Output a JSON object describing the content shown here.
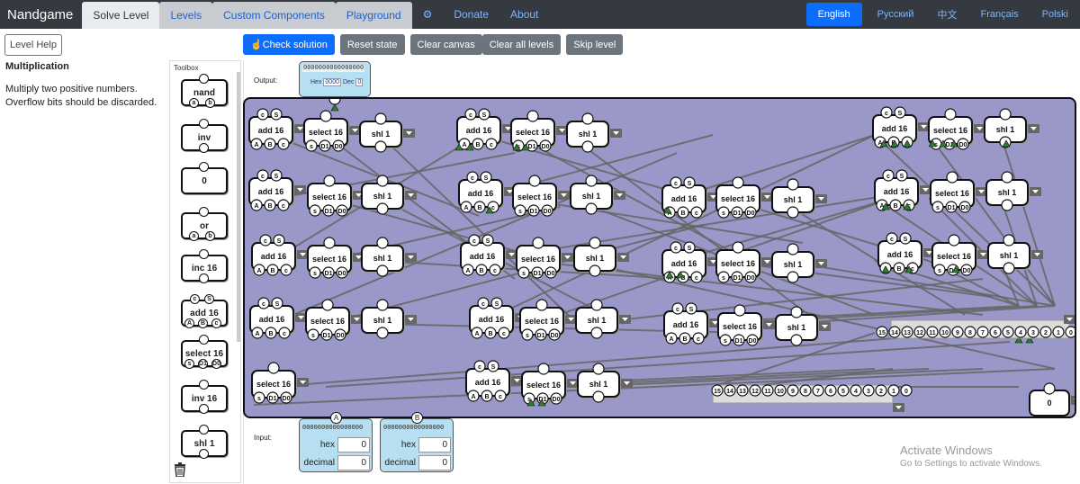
{
  "nav": {
    "brand": "Nandgame",
    "items": [
      "Solve Level",
      "Levels",
      "Custom Components",
      "Playground",
      "Donate",
      "About"
    ],
    "languages": [
      "English",
      "Русский",
      "中文",
      "Français",
      "Polski"
    ]
  },
  "level": {
    "help_label": "Level Help",
    "title": "Multiplication",
    "description": "Multiply two positive numbers. Overflow bits should be discarded."
  },
  "toolbar": {
    "check": "Check solution",
    "reset": "Reset state",
    "clear_canvas": "Clear canvas",
    "clear_levels": "Clear all levels",
    "skip": "Skip level"
  },
  "toolbox": {
    "title": "Toolbox",
    "components": [
      "nand",
      "inv",
      "0",
      "or",
      "inc 16",
      "add 16",
      "select 16",
      "inv 16",
      "shl 1"
    ]
  },
  "canvas": {
    "output_label": "Output:",
    "output_bits": "0000000000000000",
    "output_hex_label": "Hex",
    "output_hex": "0000",
    "output_dec_label": "Dec",
    "output_dec": "0",
    "input_label": "Input:",
    "inputs": [
      {
        "name": "A",
        "bits": "0000000000000000",
        "hex_label": "hex",
        "hex": "0",
        "dec_label": "decimal",
        "dec": "0"
      },
      {
        "name": "B",
        "bits": "0000000000000000",
        "hex_label": "hex",
        "hex": "0",
        "dec_label": "decimal",
        "dec": "0"
      }
    ],
    "component_labels": {
      "add": "add 16",
      "select": "select 16",
      "shl": "shl 1",
      "const": "0"
    },
    "bit_labels": [
      "15",
      "14",
      "13",
      "12",
      "11",
      "10",
      "9",
      "8",
      "7",
      "6",
      "5",
      "4",
      "3",
      "2",
      "1",
      "0"
    ]
  },
  "watermark": {
    "line1": "Activate Windows",
    "line2": "Go to Settings to activate Windows."
  },
  "colors": {
    "navbar": "#343a40",
    "board": "#9a98c8",
    "primary": "#0d6efd",
    "wire": "#666666",
    "io_box": "#b6dff1"
  }
}
